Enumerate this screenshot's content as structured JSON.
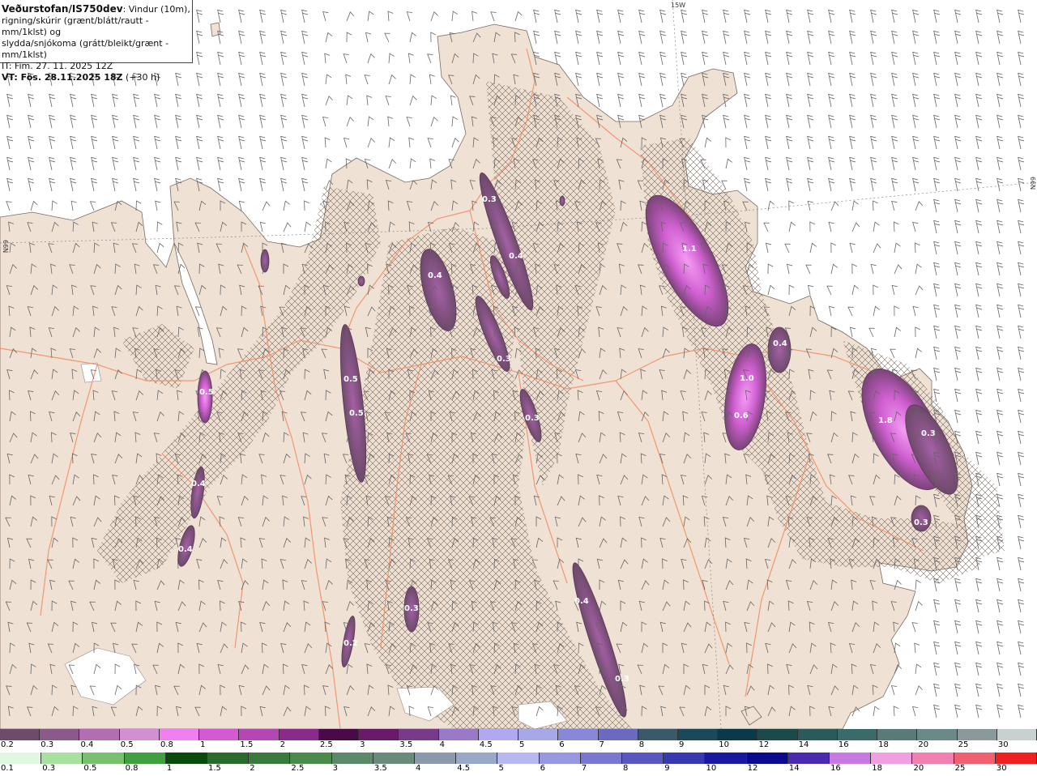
{
  "header": {
    "brand": "Veðurstofan/IS750dev",
    "line1_rest": ": Vindur (10m),",
    "line2": "rigning/skúrir (grænt/blátt/rautt - mm/1klst) og",
    "line3": "slydda/snjókoma (grátt/bleikt/grænt - mm/1klst)",
    "it": "IT: Fim. 27. 11. 2025 12Z",
    "vt_label": "VT: Fös. 28.11.2025 18Z",
    "vt_offset": " (+30 h)"
  },
  "grid_labels": {
    "top": "15W",
    "right": "66N",
    "left": "66N"
  },
  "precip_labels": [
    {
      "text": "0.3"
    },
    {
      "text": "0.4"
    },
    {
      "text": "1.1"
    },
    {
      "text": "0.4"
    },
    {
      "text": "0.3"
    },
    {
      "text": "0.4"
    },
    {
      "text": "1.0"
    },
    {
      "text": "0.6"
    },
    {
      "text": "0.5"
    },
    {
      "text": "0.5"
    },
    {
      "text": "0.5"
    },
    {
      "text": "0.3"
    },
    {
      "text": "1.8"
    },
    {
      "text": "0.3"
    },
    {
      "text": "0.4"
    },
    {
      "text": "0.4"
    },
    {
      "text": "0.3"
    },
    {
      "text": "0.3"
    },
    {
      "text": "0.4"
    },
    {
      "text": "0.2"
    },
    {
      "text": "0.3"
    }
  ],
  "scale_top": {
    "ticks": [
      "0.2",
      "0.3",
      "0.4",
      "0.5",
      "0.8",
      "1",
      "1.5",
      "2",
      "2.5",
      "3",
      "3.5",
      "4",
      "4.5",
      "5",
      "6",
      "7",
      "8",
      "9",
      "10",
      "12",
      "14",
      "16",
      "18",
      "20",
      "25",
      "30"
    ],
    "colors": [
      "#6e4a6b",
      "#8c5a8a",
      "#b36db3",
      "#d38fd3",
      "#f07ff0",
      "#d45ad4",
      "#b347b3",
      "#8a2a8a",
      "#4a0a4a",
      "#6a1a6a",
      "#7a3a8a",
      "#9a7ac8",
      "#b0a8f0",
      "#a8a8e8",
      "#8888d8",
      "#6a6ac0",
      "#3a5a6a",
      "#1a4a5a",
      "#0a3a4a",
      "#1a4a4a",
      "#2a5a5a",
      "#3a6a6a",
      "#5a7a7a",
      "#6a8a8a",
      "#8a9a9a",
      "#c8d0d0"
    ]
  },
  "scale_bottom": {
    "ticks": [
      "0.1",
      "0.3",
      "0.5",
      "0.8",
      "1",
      "1.5",
      "2",
      "2.5",
      "3",
      "3.5",
      "4",
      "4.5",
      "5",
      "6",
      "7",
      "8",
      "9",
      "10",
      "12",
      "14",
      "16",
      "18",
      "20",
      "25",
      "30"
    ],
    "colors": [
      "#e0f8e0",
      "#a8e0a0",
      "#78c070",
      "#40a040",
      "#0a4a0a",
      "#2a6a2a",
      "#3a7a3a",
      "#4a8a4a",
      "#5a8a6a",
      "#6a8a7a",
      "#8a9aaa",
      "#9aa8c8",
      "#b8b8f0",
      "#9898e0",
      "#7878d0",
      "#5858c0",
      "#3838b0",
      "#1818a0",
      "#0a0a90",
      "#4a2ab0",
      "#c87ae0",
      "#f0a0e0",
      "#f080b0",
      "#f06070",
      "#f02020"
    ]
  }
}
